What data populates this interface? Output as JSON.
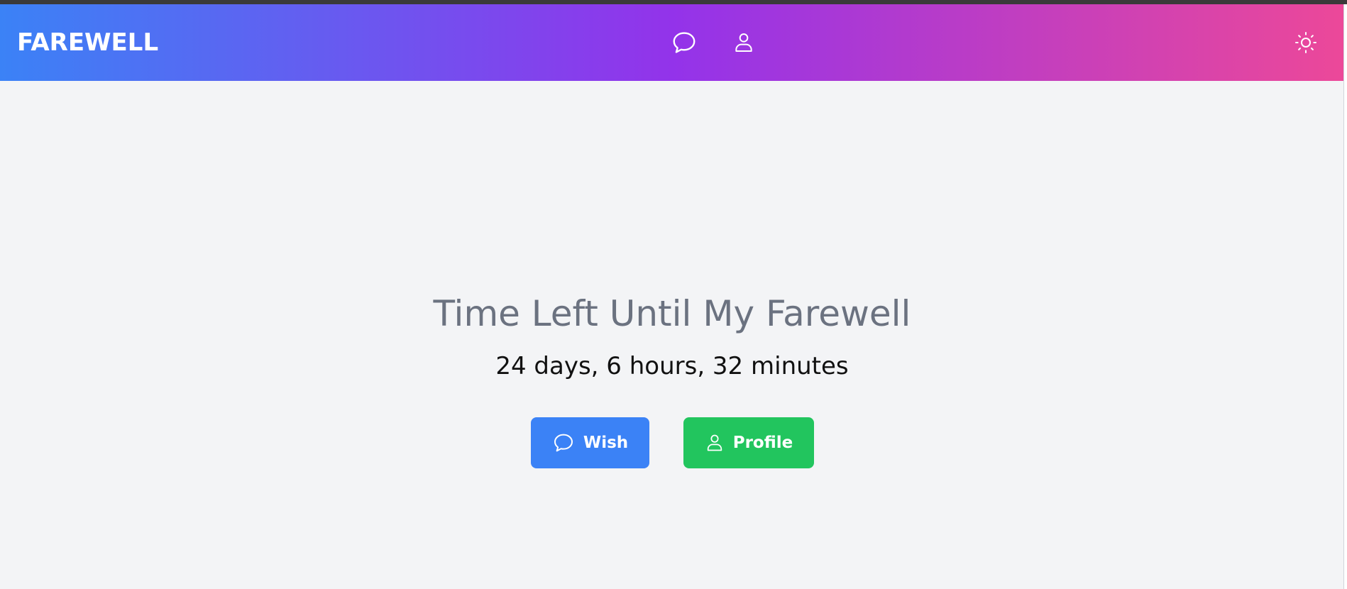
{
  "navbar": {
    "brand": "FAREWELL",
    "icons": [
      "chat-bubble-icon",
      "user-icon",
      "sun-icon"
    ]
  },
  "hero": {
    "title": "Time Left Until My Farewell",
    "countdown": "24 days, 6 hours, 32 minutes"
  },
  "buttons": {
    "wish_label": "Wish",
    "profile_label": "Profile"
  },
  "colors": {
    "gradient_start": "#3b82f6",
    "gradient_mid": "#9333ea",
    "gradient_end": "#ec4899",
    "wish_button": "#3b82f6",
    "profile_button": "#22c55e",
    "background": "#f3f4f6",
    "title_text": "#6b7280"
  }
}
